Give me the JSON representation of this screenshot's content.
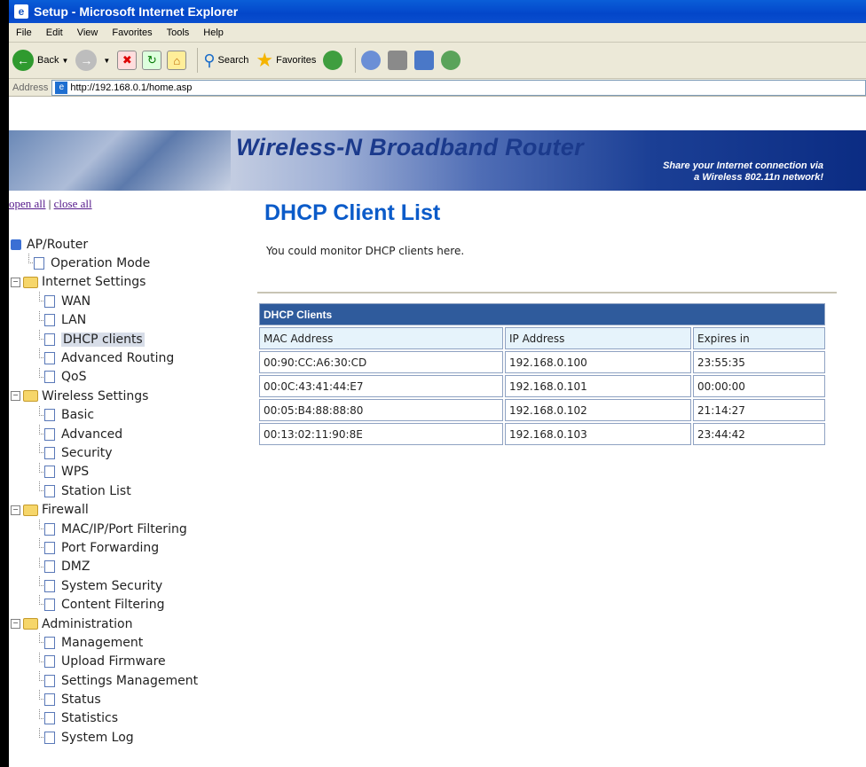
{
  "window": {
    "title": "Setup - Microsoft Internet Explorer"
  },
  "menu": [
    "File",
    "Edit",
    "View",
    "Favorites",
    "Tools",
    "Help"
  ],
  "toolbar": {
    "back": "Back",
    "search": "Search",
    "favorites": "Favorites"
  },
  "address": {
    "label": "Address",
    "url": "http://192.168.0.1/home.asp"
  },
  "banner": {
    "brand": "Wireless-N Broadband Router",
    "tagline_1": "Share your Internet connection via",
    "tagline_2": "a Wireless 802.11n network!"
  },
  "links": {
    "open_all": "open all",
    "separator": "|",
    "close_all": "close all"
  },
  "tree": {
    "root": "AP/Router",
    "operation_mode": "Operation Mode",
    "internet": "Internet Settings",
    "wan": "WAN",
    "lan": "LAN",
    "dhcp": "DHCP clients",
    "adv_routing": "Advanced Routing",
    "qos": "QoS",
    "wireless": "Wireless Settings",
    "basic": "Basic",
    "advanced": "Advanced",
    "security": "Security",
    "wps": "WPS",
    "station_list": "Station List",
    "firewall": "Firewall",
    "mac_filter": "MAC/IP/Port Filtering",
    "port_fwd": "Port Forwarding",
    "dmz": "DMZ",
    "sys_security": "System Security",
    "content_filter": "Content Filtering",
    "admin": "Administration",
    "management": "Management",
    "upload_fw": "Upload Firmware",
    "settings_mgmt": "Settings Management",
    "status": "Status",
    "statistics": "Statistics",
    "system_log": "System Log"
  },
  "page": {
    "title": "DHCP Client List",
    "description": "You could monitor DHCP clients here."
  },
  "table": {
    "caption": "DHCP Clients",
    "headers": [
      "MAC Address",
      "IP Address",
      "Expires in"
    ],
    "rows": [
      [
        "00:90:CC:A6:30:CD",
        "192.168.0.100",
        "23:55:35"
      ],
      [
        "00:0C:43:41:44:E7",
        "192.168.0.101",
        "00:00:00"
      ],
      [
        "00:05:B4:88:88:80",
        "192.168.0.102",
        "21:14:27"
      ],
      [
        "00:13:02:11:90:8E",
        "192.168.0.103",
        "23:44:42"
      ]
    ]
  }
}
